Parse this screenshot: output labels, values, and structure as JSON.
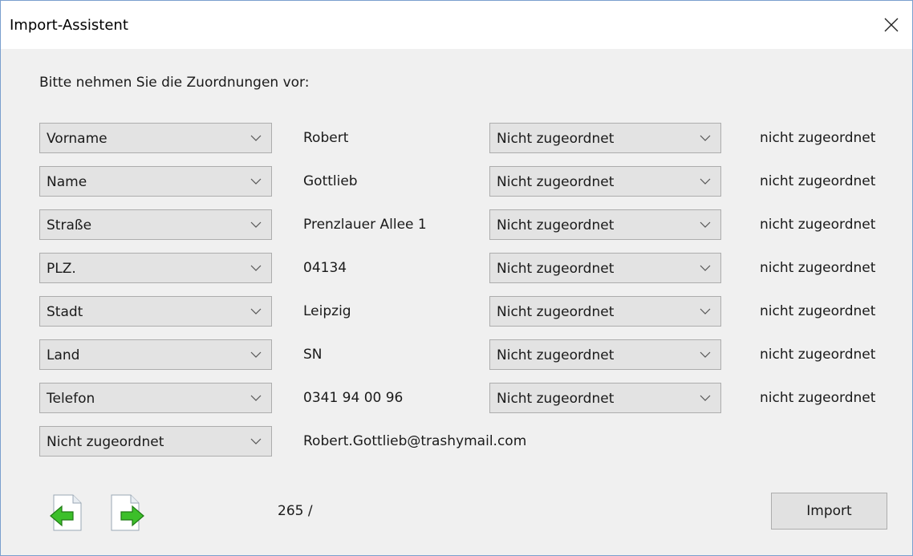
{
  "window": {
    "title": "Import-Assistent"
  },
  "instruction": "Bitte nehmen Sie die Zuordnungen vor:",
  "rows": [
    {
      "field": "Vorname",
      "value": "Robert",
      "mapping": "Nicht zugeordnet",
      "status": "nicht zugeordnet"
    },
    {
      "field": "Name",
      "value": "Gottlieb",
      "mapping": "Nicht zugeordnet",
      "status": "nicht zugeordnet"
    },
    {
      "field": "Straße",
      "value": "Prenzlauer Allee 1",
      "mapping": "Nicht zugeordnet",
      "status": "nicht zugeordnet"
    },
    {
      "field": "PLZ.",
      "value": "04134",
      "mapping": "Nicht zugeordnet",
      "status": "nicht zugeordnet"
    },
    {
      "field": "Stadt",
      "value": "Leipzig",
      "mapping": "Nicht zugeordnet",
      "status": "nicht zugeordnet"
    },
    {
      "field": "Land",
      "value": "SN",
      "mapping": "Nicht zugeordnet",
      "status": "nicht zugeordnet"
    },
    {
      "field": "Telefon",
      "value": "0341 94 00 96",
      "mapping": "Nicht zugeordnet",
      "status": "nicht zugeordnet"
    },
    {
      "field": "Nicht zugeordnet",
      "value": "Robert.Gottlieb@trashymail.com"
    }
  ],
  "footer": {
    "counter": "265 /",
    "import_label": "Import",
    "prev_icon": "previous-record-icon",
    "next_icon": "next-record-icon"
  },
  "colors": {
    "window_border": "#7a9fce",
    "background": "#f0f0f0",
    "combo_bg": "#e3e3e3",
    "arrow_green": "#3cbf2a"
  }
}
